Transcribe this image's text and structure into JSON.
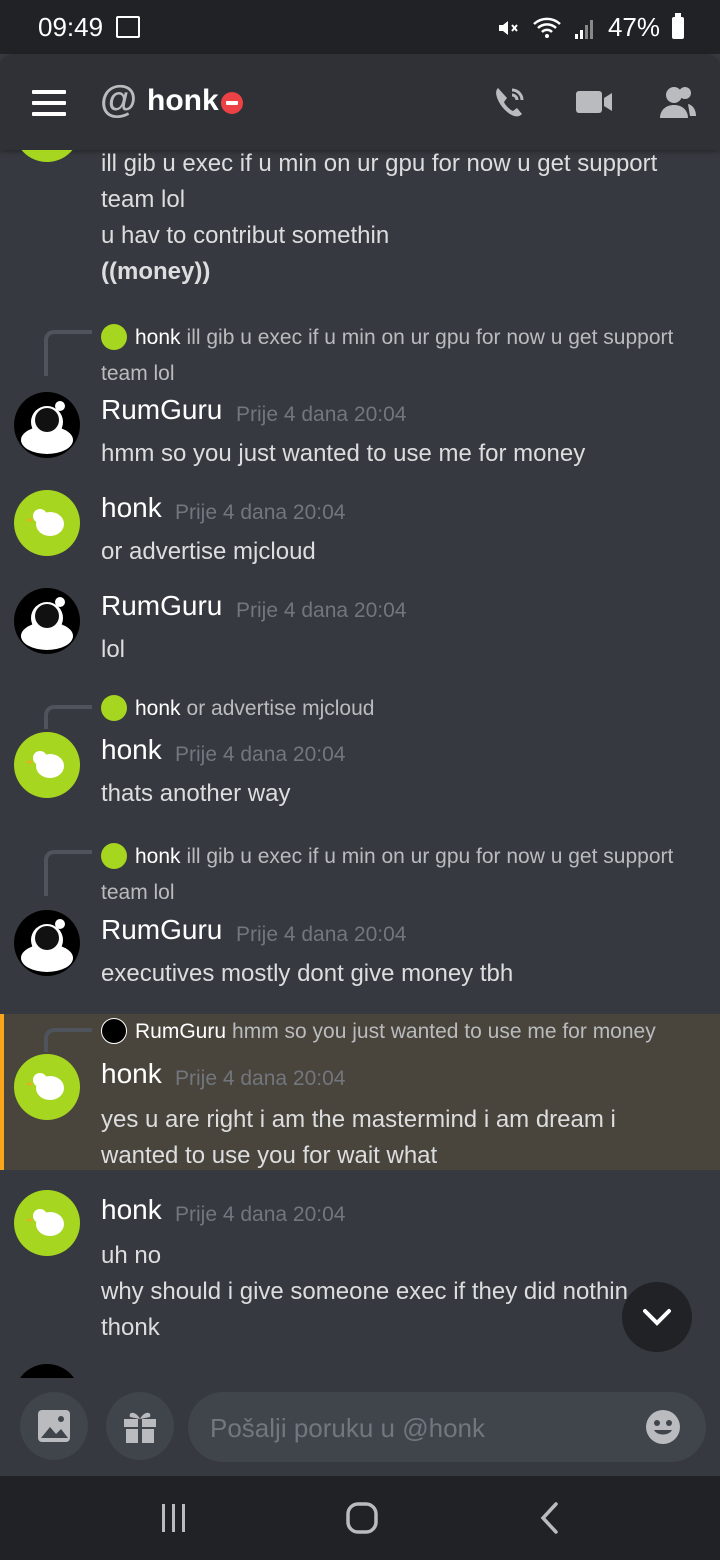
{
  "status": {
    "time": "09:49",
    "battery": "47%"
  },
  "header": {
    "title": "honk",
    "at_symbol": "@"
  },
  "messages": {
    "top_lines": [
      "ill gib u exec if u min on ur gpu for now u get support team lol",
      "u hav to contribut somethin",
      "(money)"
    ],
    "reply1": {
      "name": "honk",
      "text": "ill gib u exec if u min on ur gpu for now u get support",
      "text2": "team lol"
    },
    "m1": {
      "author": "RumGuru",
      "time": "Prije 4 dana 20:04",
      "text": "hmm so you just wanted to use me for money"
    },
    "m2": {
      "author": "honk",
      "time": "Prije 4 dana 20:04",
      "text": "or advertise mjcloud"
    },
    "m3": {
      "author": "RumGuru",
      "time": "Prije 4 dana 20:04",
      "text": "lol"
    },
    "reply2": {
      "name": "honk",
      "text": "or advertise mjcloud"
    },
    "m4": {
      "author": "honk",
      "time": "Prije 4 dana 20:04",
      "text": "thats another way"
    },
    "reply3": {
      "name": "honk",
      "text": "ill gib u exec if u min on ur gpu for now u get support",
      "text2": "team lol"
    },
    "m5": {
      "author": "RumGuru",
      "time": "Prije 4 dana 20:04",
      "text": "executives mostly dont give money tbh"
    },
    "reply4": {
      "name": "RumGuru",
      "text": "hmm so you just wanted to use me for money"
    },
    "m6": {
      "author": "honk",
      "time": "Prije 4 dana 20:04",
      "text": "yes u are right i am the mastermind i am dream i",
      "text2": "wanted to use you for wait what"
    },
    "m7": {
      "author": "honk",
      "time": "Prije 4 dana 20:04",
      "text": "uh no",
      "text2": "why should i give someone exec if they did nothin",
      "text3": "thonk"
    }
  },
  "composer": {
    "placeholder": "Pošalji poruku u @honk"
  },
  "colors": {
    "background": "#36393f",
    "header": "#2f3136",
    "dnd": "#ed4245",
    "mention": "#faa61a",
    "honk_avatar": "#a6d61f"
  }
}
